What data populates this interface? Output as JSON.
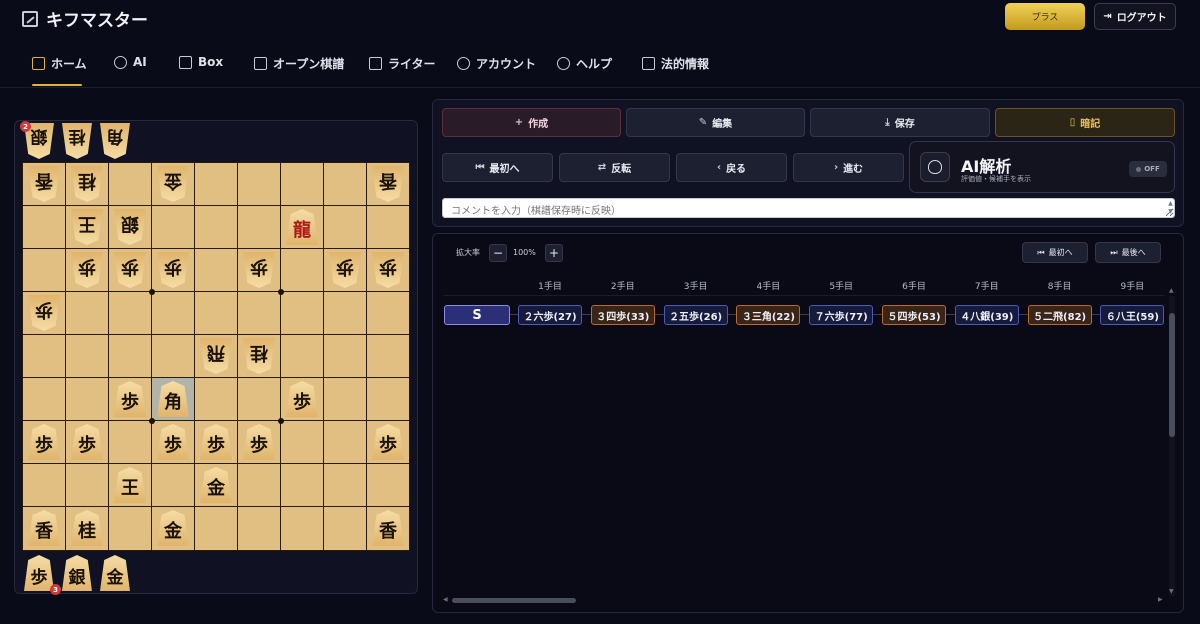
{
  "app": {
    "title": "キフマスター",
    "plus_label": "プラス",
    "logout_label": "ログアウト"
  },
  "nav": [
    {
      "label": "ホーム",
      "icon": "home-icon",
      "active": true
    },
    {
      "label": "AI",
      "icon": "brain-icon"
    },
    {
      "label": "Box",
      "icon": "box-icon"
    },
    {
      "label": "オープン棋譜",
      "icon": "layers-icon"
    },
    {
      "label": "ライター",
      "icon": "pen-icon"
    },
    {
      "label": "アカウント",
      "icon": "user-icon"
    },
    {
      "label": "ヘルプ",
      "icon": "help-icon"
    },
    {
      "label": "法的情報",
      "icon": "document-icon"
    }
  ],
  "board": {
    "gote_hand": [
      {
        "piece": "銀",
        "count": "2"
      },
      {
        "piece": "桂"
      },
      {
        "piece": "角"
      }
    ],
    "sente_hand": [
      {
        "piece": "歩",
        "count": "3"
      },
      {
        "piece": "銀"
      },
      {
        "piece": "金"
      }
    ],
    "pieces": [
      {
        "r": 0,
        "c": 0,
        "p": "香",
        "side": "gote"
      },
      {
        "r": 0,
        "c": 1,
        "p": "桂",
        "side": "gote"
      },
      {
        "r": 0,
        "c": 3,
        "p": "金",
        "side": "gote"
      },
      {
        "r": 0,
        "c": 8,
        "p": "香",
        "side": "gote"
      },
      {
        "r": 1,
        "c": 1,
        "p": "王",
        "side": "gote"
      },
      {
        "r": 1,
        "c": 2,
        "p": "銀",
        "side": "gote"
      },
      {
        "r": 1,
        "c": 6,
        "p": "龍",
        "side": "sente",
        "promoted": true
      },
      {
        "r": 2,
        "c": 1,
        "p": "歩",
        "side": "gote"
      },
      {
        "r": 2,
        "c": 2,
        "p": "歩",
        "side": "gote"
      },
      {
        "r": 2,
        "c": 3,
        "p": "歩",
        "side": "gote"
      },
      {
        "r": 2,
        "c": 5,
        "p": "歩",
        "side": "gote"
      },
      {
        "r": 2,
        "c": 7,
        "p": "歩",
        "side": "gote"
      },
      {
        "r": 2,
        "c": 8,
        "p": "歩",
        "side": "gote"
      },
      {
        "r": 3,
        "c": 0,
        "p": "歩",
        "side": "gote"
      },
      {
        "r": 4,
        "c": 4,
        "p": "飛",
        "side": "gote"
      },
      {
        "r": 4,
        "c": 5,
        "p": "桂",
        "side": "gote"
      },
      {
        "r": 5,
        "c": 2,
        "p": "歩",
        "side": "sente"
      },
      {
        "r": 5,
        "c": 3,
        "p": "角",
        "side": "sente"
      },
      {
        "r": 5,
        "c": 6,
        "p": "歩",
        "side": "sente"
      },
      {
        "r": 6,
        "c": 0,
        "p": "歩",
        "side": "sente"
      },
      {
        "r": 6,
        "c": 1,
        "p": "歩",
        "side": "sente"
      },
      {
        "r": 6,
        "c": 3,
        "p": "歩",
        "side": "sente"
      },
      {
        "r": 6,
        "c": 4,
        "p": "歩",
        "side": "sente"
      },
      {
        "r": 6,
        "c": 5,
        "p": "歩",
        "side": "sente"
      },
      {
        "r": 6,
        "c": 8,
        "p": "歩",
        "side": "sente"
      },
      {
        "r": 7,
        "c": 2,
        "p": "王",
        "side": "sente"
      },
      {
        "r": 7,
        "c": 4,
        "p": "金",
        "side": "sente"
      },
      {
        "r": 8,
        "c": 0,
        "p": "香",
        "side": "sente"
      },
      {
        "r": 8,
        "c": 1,
        "p": "桂",
        "side": "sente"
      },
      {
        "r": 8,
        "c": 3,
        "p": "金",
        "side": "sente"
      },
      {
        "r": 8,
        "c": 8,
        "p": "香",
        "side": "sente"
      }
    ],
    "highlight": {
      "r": 5,
      "c": 3
    }
  },
  "controls": {
    "create": "作成",
    "edit": "編集",
    "save": "保存",
    "memorize": "暗記",
    "first": "最初へ",
    "flip": "反転",
    "back": "戻る",
    "forward": "進む"
  },
  "ai": {
    "title": "AI解析",
    "subtitle": "評価値・候補手を表示",
    "toggle": "OFF"
  },
  "comment": {
    "placeholder": "コメントを入力（棋譜保存時に反映）"
  },
  "zoom": {
    "label": "拡大率",
    "value": "100%",
    "minus": "−",
    "plus": "+"
  },
  "moves_nav": {
    "first": "最初へ",
    "last": "最後へ"
  },
  "moves": {
    "start": "S",
    "headers": [
      "1手目",
      "2手目",
      "3手目",
      "4手目",
      "5手目",
      "6手目",
      "7手目",
      "8手目",
      "9手目"
    ],
    "items": [
      {
        "text": "２六歩(27)",
        "color": "blue"
      },
      {
        "text": "３四歩(33)",
        "color": "orange"
      },
      {
        "text": "２五歩(26)",
        "color": "blue"
      },
      {
        "text": "３三角(22)",
        "color": "orange"
      },
      {
        "text": "７六歩(77)",
        "color": "blue"
      },
      {
        "text": "５四歩(53)",
        "color": "orange"
      },
      {
        "text": "４八銀(39)",
        "color": "blue"
      },
      {
        "text": "５二飛(82)",
        "color": "orange"
      },
      {
        "text": "６八王(59)",
        "color": "blue"
      }
    ]
  },
  "colors": {
    "accent": "#e0b23a",
    "background": "#0a0b18",
    "chip_blue": "#4d5bb5",
    "chip_orange": "#b96b2d"
  }
}
